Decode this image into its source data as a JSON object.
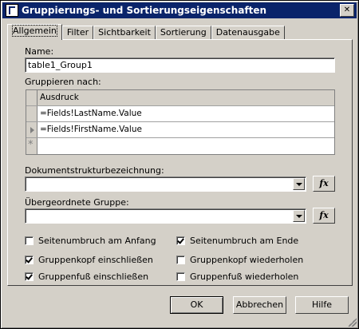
{
  "window": {
    "title": "Gruppierungs- und Sortierungseigenschaften",
    "close": "✕"
  },
  "tabs": [
    "Allgemein",
    "Filter",
    "Sichtbarkeit",
    "Sortierung",
    "Datenausgabe"
  ],
  "name": {
    "label": "Name:",
    "value": "table1_Group1"
  },
  "group_by": {
    "label": "Gruppieren nach:",
    "column": "Ausdruck",
    "rows": [
      "=Fields!LastName.Value",
      "=Fields!FirstName.Value",
      ""
    ]
  },
  "doc_map": {
    "label": "Dokumentstrukturbezeichnung:",
    "value": "",
    "fx": "fx"
  },
  "parent_group": {
    "label": "Übergeordnete Gruppe:",
    "value": "",
    "fx": "fx"
  },
  "checkboxes": {
    "page_break_start": {
      "label": "Seitenumbruch am Anfang",
      "checked": false
    },
    "page_break_end": {
      "label": "Seitenumbruch am Ende",
      "checked": true
    },
    "include_header": {
      "label": "Gruppenkopf einschließen",
      "checked": true
    },
    "repeat_header": {
      "label": "Gruppenkopf wiederholen",
      "checked": false
    },
    "include_footer": {
      "label": "Gruppenfuß einschließen",
      "checked": true
    },
    "repeat_footer": {
      "label": "Gruppenfuß wiederholen",
      "checked": false
    }
  },
  "buttons": {
    "ok": "OK",
    "cancel": "Abbrechen",
    "help": "Hilfe"
  }
}
